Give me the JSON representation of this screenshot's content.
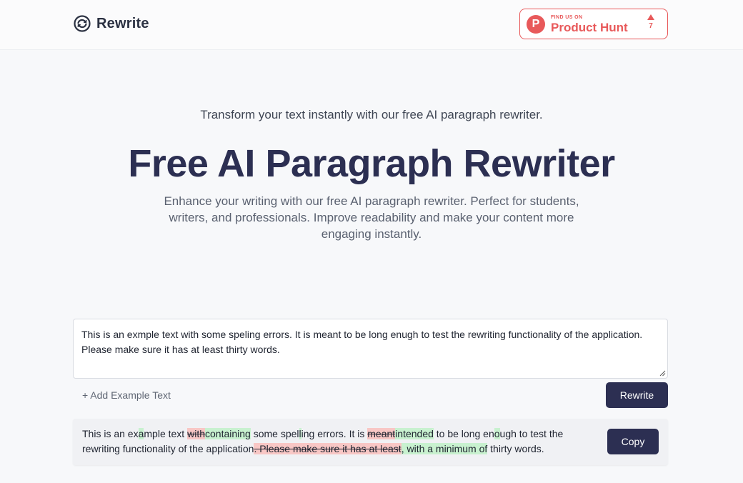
{
  "header": {
    "logo_text": "Rewrite",
    "badge": {
      "small": "FIND US ON",
      "big": "Product Hunt",
      "votes": "7",
      "letter": "P"
    }
  },
  "hero": {
    "subtitle": "Transform your text instantly with our free AI paragraph rewriter.",
    "title": "Free AI Paragraph Rewriter",
    "description": "Enhance your writing with our free AI paragraph rewriter. Perfect for students, writers, and professionals. Improve readability and make your content more engaging instantly."
  },
  "editor": {
    "input_value": "This is an exmple text with some speling errors. It is meant to be long enugh to test the rewriting functionality of the application. Please make sure it has at least thirty words.",
    "add_example_label": "+ Add Example Text",
    "rewrite_label": "Rewrite"
  },
  "result": {
    "segments": [
      {
        "t": "This is an ex",
        "k": "same"
      },
      {
        "t": "a",
        "k": "ins"
      },
      {
        "t": "mple text ",
        "k": "same"
      },
      {
        "t": "with",
        "k": "del"
      },
      {
        "t": "containing",
        "k": "ins"
      },
      {
        "t": " some spel",
        "k": "same"
      },
      {
        "t": "l",
        "k": "ins"
      },
      {
        "t": "ing errors. It is ",
        "k": "same"
      },
      {
        "t": "meant",
        "k": "del"
      },
      {
        "t": "intended",
        "k": "ins"
      },
      {
        "t": " to be long en",
        "k": "same"
      },
      {
        "t": "o",
        "k": "ins"
      },
      {
        "t": "ugh to test the rewriting functionality of the application",
        "k": "same"
      },
      {
        "t": ". Please make sure it has at least",
        "k": "del"
      },
      {
        "t": ", with a minimum of",
        "k": "ins"
      },
      {
        "t": " thirty words.",
        "k": "same"
      }
    ],
    "copy_label": "Copy"
  },
  "colors": {
    "accent": "#2c2f52",
    "product_hunt": "#e8595a",
    "diff_deleted": "#f8c7c5",
    "diff_inserted": "#c8f1cf"
  },
  "icons": {
    "logo": "refresh-arrows-icon",
    "upvote": "triangle-up-icon",
    "resize": "resize-grip-icon"
  }
}
